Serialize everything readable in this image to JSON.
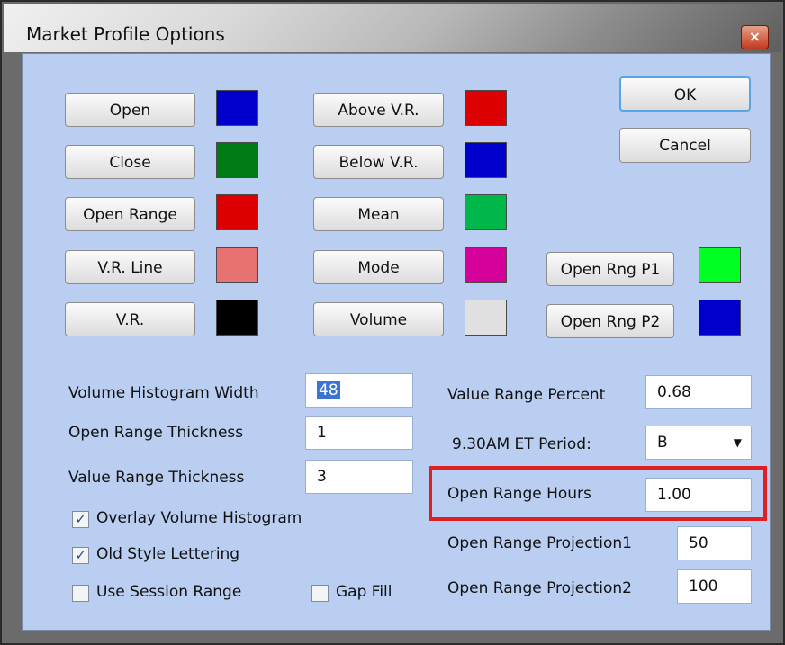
{
  "window": {
    "title": "Market Profile Options",
    "close_glyph": "×"
  },
  "color_buttons": {
    "col1": [
      {
        "label": "Open",
        "color": "#0000cc"
      },
      {
        "label": "Close",
        "color": "#007a14"
      },
      {
        "label": "Open Range",
        "color": "#dd0000"
      },
      {
        "label": "V.R. Line",
        "color": "#e87272"
      },
      {
        "label": "V.R.",
        "color": "#000000"
      }
    ],
    "col2": [
      {
        "label": "Above V.R.",
        "color": "#dd0000"
      },
      {
        "label": "Below V.R.",
        "color": "#0000cc"
      },
      {
        "label": "Mean",
        "color": "#00b84a"
      },
      {
        "label": "Mode",
        "color": "#d6009a"
      },
      {
        "label": "Volume",
        "color": "#e0e0e0"
      }
    ],
    "col3": [
      {
        "label": "Open Rng P1",
        "color": "#00ff22"
      },
      {
        "label": "Open Rng P2",
        "color": "#0000cc"
      }
    ]
  },
  "actions": {
    "ok": "OK",
    "cancel": "Cancel"
  },
  "left_fields": [
    {
      "label": "Volume Histogram Width",
      "value": "48"
    },
    {
      "label": "Open Range Thickness",
      "value": "1"
    },
    {
      "label": "Value Range Thickness",
      "value": "3"
    }
  ],
  "checkboxes": [
    {
      "label": "Overlay Volume Histogram",
      "checked": true
    },
    {
      "label": "Old Style Lettering",
      "checked": true
    },
    {
      "label": "Use Session Range",
      "checked": false
    },
    {
      "label": "Gap Fill",
      "checked": false
    }
  ],
  "right_fields": [
    {
      "label": "Value Range Percent",
      "value": "0.68"
    },
    {
      "label": "9.30AM ET Period:",
      "value": "B"
    },
    {
      "label": "Open Range Hours",
      "value": "1.00"
    },
    {
      "label": "Open Range Projection1",
      "value": "50"
    },
    {
      "label": "Open Range Projection2",
      "value": "100"
    }
  ],
  "check_glyph": "✓",
  "dropdown_glyph": "▼"
}
